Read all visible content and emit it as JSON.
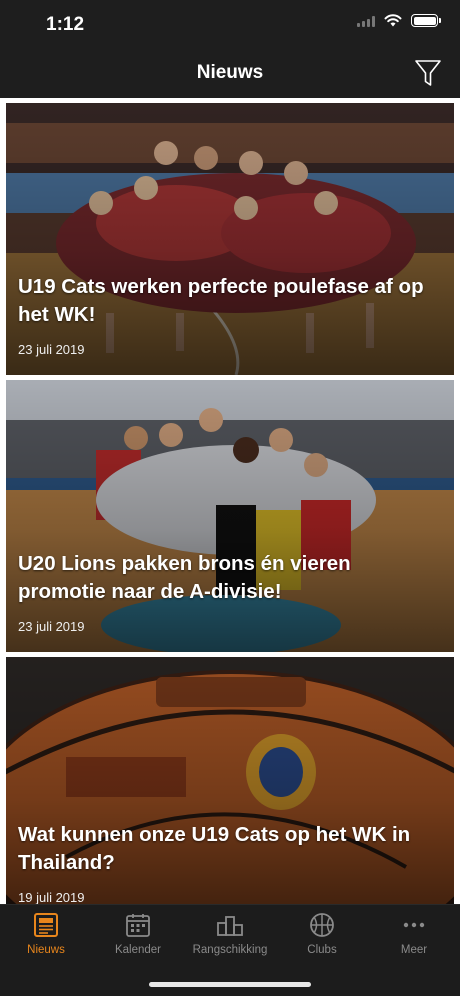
{
  "status_bar": {
    "time": "1:12"
  },
  "nav": {
    "title": "Nieuws",
    "filter_icon": "filter-icon"
  },
  "articles": [
    {
      "title": "U19 Cats werken perfecte poulefase af op het WK!",
      "date": "23 juli 2019"
    },
    {
      "title": "U20 Lions pakken brons én vieren promotie naar de A-divisie!",
      "date": "23 juli 2019"
    },
    {
      "title": "Wat kunnen onze U19 Cats op het WK in Thailand?",
      "date": "19 juli 2019"
    }
  ],
  "tabs": [
    {
      "label": "Nieuws",
      "icon": "newspaper-icon",
      "active": true
    },
    {
      "label": "Kalender",
      "icon": "calendar-icon",
      "active": false
    },
    {
      "label": "Rangschikking",
      "icon": "standings-icon",
      "active": false
    },
    {
      "label": "Clubs",
      "icon": "basketball-icon",
      "active": false
    },
    {
      "label": "Meer",
      "icon": "more-icon",
      "active": false
    }
  ],
  "colors": {
    "accent": "#e8861c",
    "bars": "#1e1e1e",
    "inactive": "#8a8a8a"
  }
}
